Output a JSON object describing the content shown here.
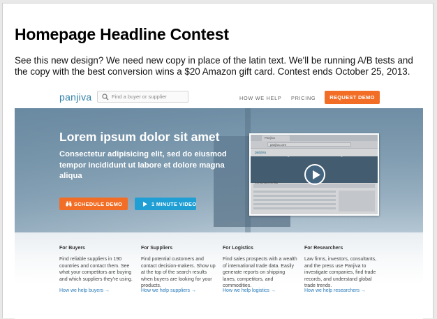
{
  "page": {
    "headline": "Homepage Headline Contest",
    "intro": "See this new design? We need new copy in place of the latin text. We'll be running A/B tests and the copy with the best conversion wins a $20 Amazon gift card. Contest ends October 25, 2013."
  },
  "mockup": {
    "nav": {
      "logo": "panjiva",
      "search_placeholder": "Find a buyer or supplier",
      "links": [
        "HOW WE HELP",
        "PRICING"
      ],
      "cta": "REQUEST DEMO"
    },
    "hero": {
      "title": "Lorem ipsum dolor sit amet",
      "subtitle": "Consectetur adipisicing elit, sed do eiusmod tempor incididunt ut labore et dolore magna aliqua",
      "schedule_button": "SCHEDULE DEMO",
      "video_button": "1 MINUTE VIDEO"
    },
    "video": {
      "tab": "Panjiva",
      "url": "panjiva.com",
      "app_logo": "panjiva",
      "company": "Ningbo Shenzhou Knitting Co., Ltd.",
      "section": "Aggregate Profile"
    },
    "columns": [
      {
        "heading": "For Buyers",
        "body": "Find reliable suppliers in 190 countries and contact them. See what your competitors are buying and which suppliers they're using.",
        "link": "How we help buyers →"
      },
      {
        "heading": "For Suppliers",
        "body": "Find potential customers and contact decision-makers. Show up at the top of the search results when buyers are looking for your products.",
        "link": "How we help suppliers →"
      },
      {
        "heading": "For Logistics",
        "body": "Find sales prospects with a wealth of international trade data. Easily generate reports on shipping lanes, competitors, and commodities.",
        "link": "How we help logistics →"
      },
      {
        "heading": "For Researchers",
        "body": "Law firms, investors, consultants, and the press use Panjiva to investigate companies, find trade records, and understand global trade trends.",
        "link": "How we help researchers →"
      }
    ]
  },
  "colors": {
    "accent_orange": "#f26e26",
    "accent_blue": "#1f9fd4",
    "link_blue": "#2478b8",
    "logo_blue": "#2f7fa8"
  },
  "icons": [
    "search-icon",
    "binoculars-icon",
    "play-icon",
    "play-circle-icon"
  ]
}
